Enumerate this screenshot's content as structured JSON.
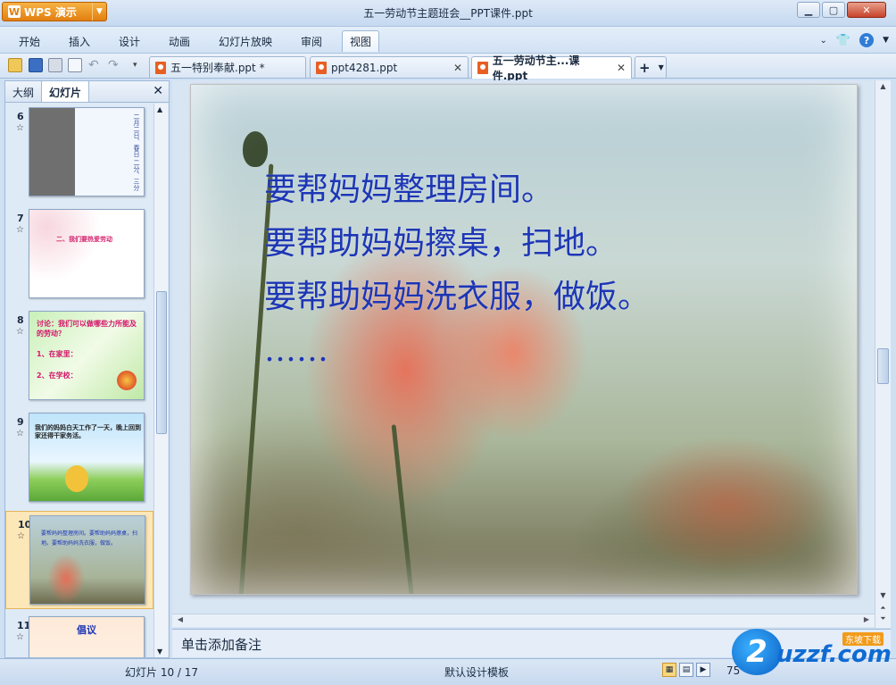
{
  "app": {
    "name": "WPS 演示",
    "window_title": "五一劳动节主题班会__PPT课件.ppt"
  },
  "menu": {
    "items": [
      "开始",
      "插入",
      "设计",
      "动画",
      "幻灯片放映",
      "审阅",
      "视图"
    ]
  },
  "tabs": [
    {
      "label": "五一特别奉献.ppt *",
      "active": false
    },
    {
      "label": "ppt4281.ppt",
      "active": false
    },
    {
      "label": "五一劳动节主...课件.ppt",
      "active": true
    }
  ],
  "left_panel": {
    "tabs": [
      "大纲",
      "幻灯片"
    ],
    "active_tab": "幻灯片",
    "slides": [
      {
        "num": "6",
        "text": "二月二日、春日 二分、三分"
      },
      {
        "num": "7",
        "text": "二、我们要热爱劳动"
      },
      {
        "num": "8",
        "text": "讨论：我们可以做哪些力所能及的劳动？",
        "items": [
          "1、在家里：",
          "2、在学校："
        ]
      },
      {
        "num": "9",
        "text": "我们的妈妈白天工作了一天，晚上回到家还得干家务活。"
      },
      {
        "num": "10",
        "text": "要帮妈妈整理房间。要帮助妈妈擦桌，扫地。要帮助妈妈洗衣服，做饭。",
        "selected": true
      },
      {
        "num": "11",
        "text": "倡议"
      }
    ]
  },
  "slide": {
    "lines": [
      "要帮妈妈整理房间。",
      "要帮助妈妈擦桌，扫地。",
      "要帮助妈妈洗衣服，做饭。",
      "……"
    ],
    "text_color": "#1d36b6"
  },
  "notes": {
    "placeholder": "单击添加备注"
  },
  "status": {
    "slide_counter": "幻灯片 10 / 17",
    "template": "默认设计模板",
    "zoom": "75"
  },
  "watermark": {
    "text": "uzzf.com",
    "badge": "东坡下载"
  }
}
